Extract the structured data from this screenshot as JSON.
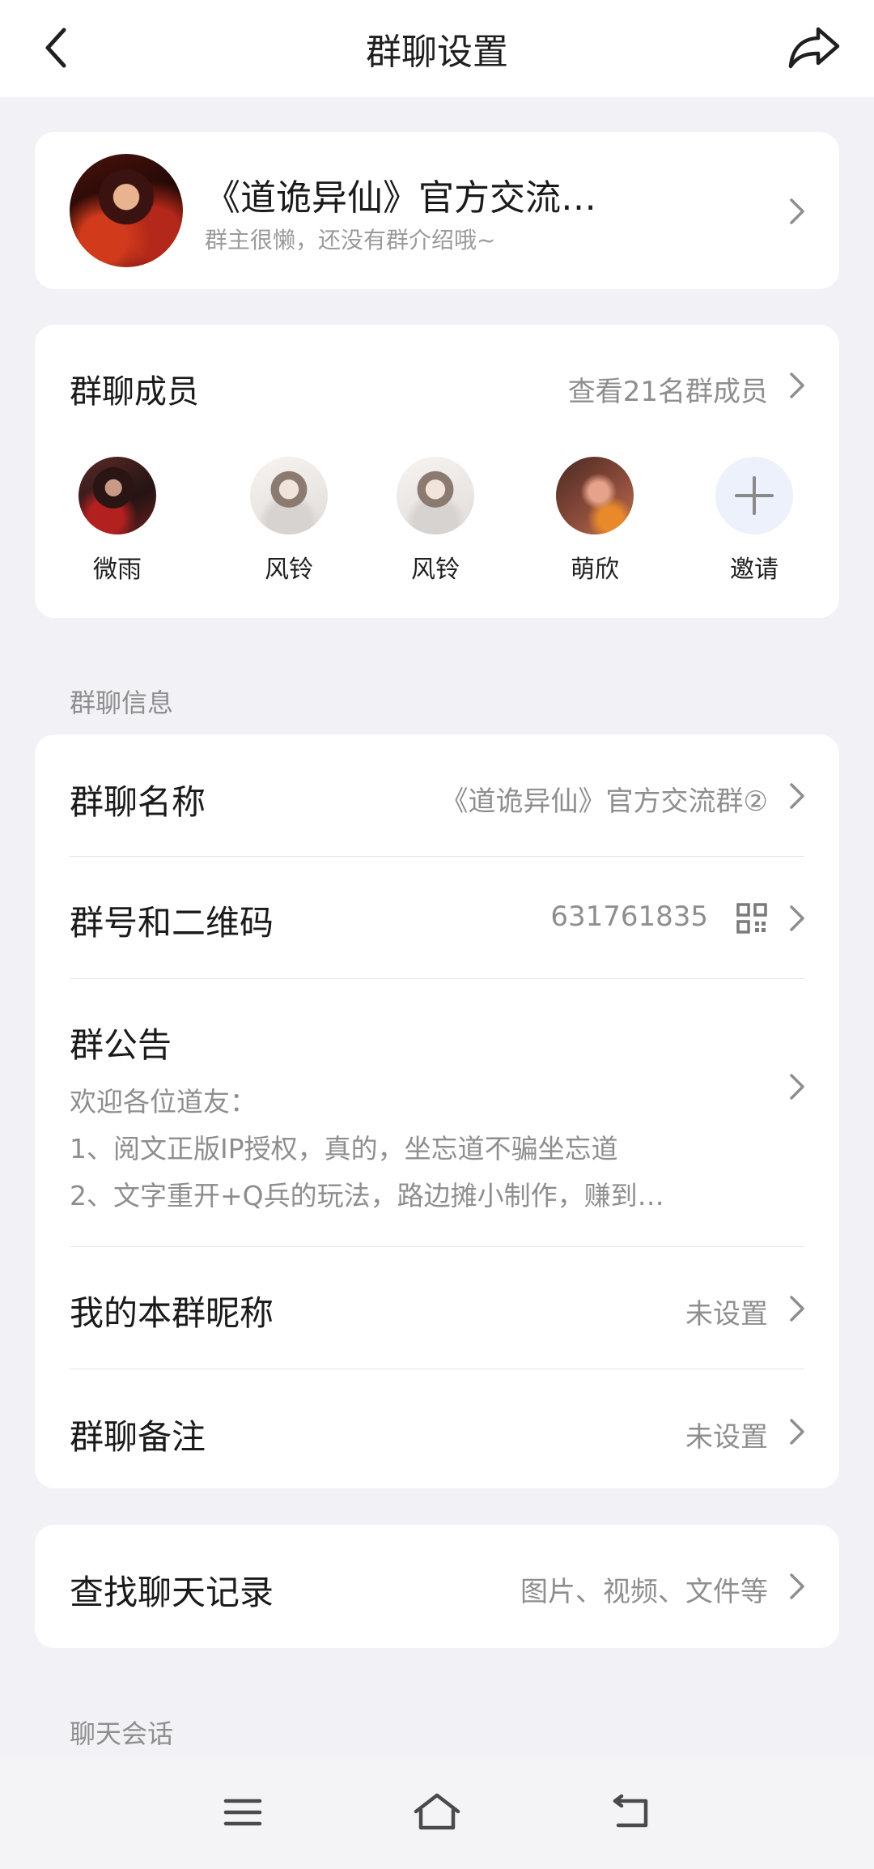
{
  "header": {
    "title": "群聊设置"
  },
  "group": {
    "name": "《道诡异仙》官方交流…",
    "description": "群主很懒，还没有群介绍哦~"
  },
  "members": {
    "title": "群聊成员",
    "view_all": "查看21名群成员",
    "list": [
      {
        "name": "微雨"
      },
      {
        "name": "风铃"
      },
      {
        "name": "风铃"
      },
      {
        "name": "萌欣"
      }
    ],
    "invite_label": "邀请"
  },
  "info_section": {
    "label": "群聊信息",
    "group_name_label": "群聊名称",
    "group_name_value": "《道诡异仙》官方交流群②",
    "group_id_label": "群号和二维码",
    "group_id_value": "631761835",
    "notice_label": "群公告",
    "notice_lines": [
      "欢迎各位道友：",
      "1、阅文正版IP授权，真的，坐忘道不骗坐忘道",
      "2、文字重开+Q兵的玩法，路边摊小制作，赚到…"
    ],
    "nickname_label": "我的本群昵称",
    "nickname_value": "未设置",
    "remark_label": "群聊备注",
    "remark_value": "未设置"
  },
  "search_history": {
    "label": "查找聊天记录",
    "value": "图片、视频、文件等"
  },
  "chat_section": {
    "label": "聊天会话"
  },
  "icons": {
    "back": "chevron-left-icon",
    "share": "share-icon",
    "chevron": "chevron-right-icon",
    "qr": "qr-code-icon",
    "invite": "plus-icon",
    "nav_menu": "menu-icon",
    "nav_home": "home-icon",
    "nav_back": "back-icon"
  }
}
